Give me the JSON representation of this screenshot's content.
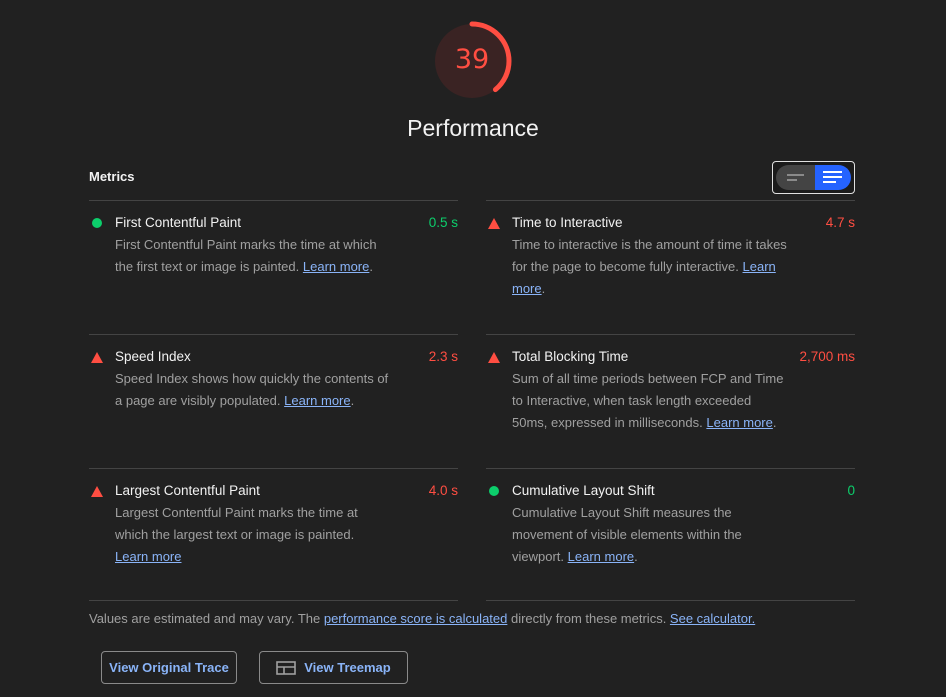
{
  "score": {
    "value": 39,
    "label": "39",
    "title": "Performance",
    "color": "#ff4e42",
    "fraction": 0.39
  },
  "metrics_header": "Metrics",
  "view_toggle": {
    "options": [
      "collapsed-view",
      "expanded-view"
    ],
    "selected": "expanded-view",
    "accent_color": "#2563ff"
  },
  "metrics": [
    {
      "title": "First Contentful Paint",
      "value": "0.5 s",
      "status": "pass",
      "icon": "green-circle-icon",
      "description": "First Contentful Paint marks the time at which the first text or image is painted.",
      "link": "Learn more",
      "suffix": "."
    },
    {
      "title": "Time to Interactive",
      "value": "4.7 s",
      "status": "fail",
      "icon": "red-triangle-icon",
      "description": "Time to interactive is the amount of time it takes for the page to become fully interactive.",
      "link": "Learn more",
      "suffix": "."
    },
    {
      "title": "Speed Index",
      "value": "2.3 s",
      "status": "fail",
      "icon": "red-triangle-icon",
      "description": "Speed Index shows how quickly the contents of a page are visibly populated.",
      "link": "Learn more",
      "suffix": "."
    },
    {
      "title": "Total Blocking Time",
      "value": "2,700 ms",
      "status": "fail",
      "icon": "red-triangle-icon",
      "description": "Sum of all time periods between FCP and Time to Interactive, when task length exceeded 50ms, expressed in milliseconds.",
      "link": "Learn more",
      "suffix": "."
    },
    {
      "title": "Largest Contentful Paint",
      "value": "4.0 s",
      "status": "fail",
      "icon": "red-triangle-icon",
      "description": "Largest Contentful Paint marks the time at which the largest text or image is painted.",
      "link": "Learn more",
      "suffix": ""
    },
    {
      "title": "Cumulative Layout Shift",
      "value": "0",
      "status": "pass",
      "icon": "green-circle-icon",
      "description": "Cumulative Layout Shift measures the movement of visible elements within the viewport.",
      "link": "Learn more",
      "suffix": "."
    }
  ],
  "footnote": {
    "prefix": "Values are estimated and may vary. The ",
    "link1": "performance score is calculated",
    "middle": " directly from these metrics. ",
    "link2": "See calculator."
  },
  "buttons": {
    "view_trace": "View Original Trace",
    "view_treemap": "View Treemap"
  },
  "colors": {
    "pass": "#0cce6b",
    "fail": "#ff4e42",
    "link": "#8ab4f8",
    "background": "#212121"
  }
}
